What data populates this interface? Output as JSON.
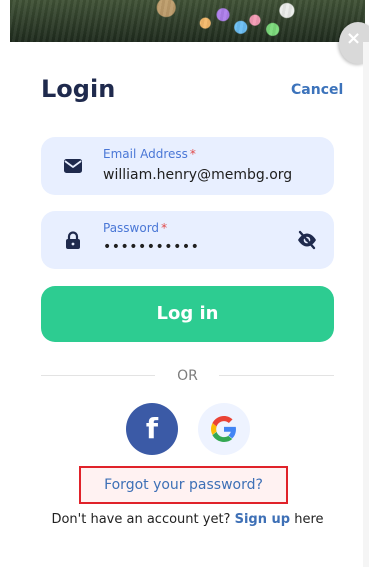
{
  "header": {
    "title": "Login",
    "cancel_label": "Cancel",
    "close_icon": "×"
  },
  "form": {
    "email": {
      "label": "Email Address",
      "required_mark": "*",
      "value": "william.henry@membg.org"
    },
    "password": {
      "label": "Password",
      "required_mark": "*",
      "value": "•••••••••••"
    },
    "submit_label": "Log in"
  },
  "divider": {
    "text": "OR"
  },
  "social": {
    "facebook_label": "f"
  },
  "links": {
    "forgot_password": "Forgot your password?",
    "signup_prefix": "Don't have an account yet?",
    "signup_label": "Sign up",
    "signup_suffix": "here"
  },
  "colors": {
    "accent": "#2dcc91",
    "title": "#1f2a4d",
    "link": "#3e70b6",
    "field_background": "#e8efff",
    "highlight": "#e0222a"
  },
  "icons": {
    "email": "envelope-icon",
    "password": "lock-icon",
    "visibility": "eye-slash-icon",
    "close": "close-icon",
    "facebook": "facebook-icon",
    "google": "google-icon"
  }
}
